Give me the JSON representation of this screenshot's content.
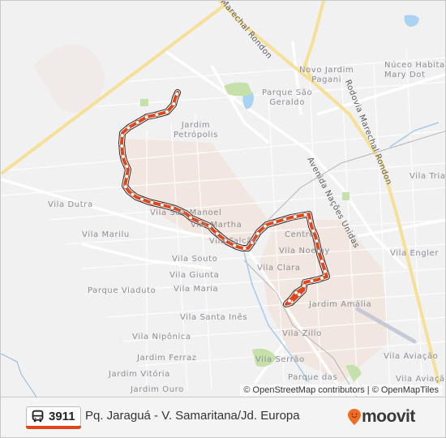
{
  "map": {
    "places": [
      {
        "id": "nucleo",
        "label": "Núceo Habita\nMary Dot"
      },
      {
        "id": "novo-jardim-pagani",
        "label": "Novo Jardim\nPagani"
      },
      {
        "id": "parque-sao-geraldo",
        "label": "Parque São\nGeraldo"
      },
      {
        "id": "jardim-petropolis",
        "label": "Jardim\nPetrópolis"
      },
      {
        "id": "vila-dutra",
        "label": "Vila Dutra"
      },
      {
        "id": "vila-marilu",
        "label": "Vila Marilu"
      },
      {
        "id": "vila-sao-manoel",
        "label": "Vila São Manoel"
      },
      {
        "id": "vila-martha",
        "label": "Vila Martha"
      },
      {
        "id": "vila-falcao",
        "label": "Vila Falcão"
      },
      {
        "id": "centro",
        "label": "Centro"
      },
      {
        "id": "vila-noemy",
        "label": "Vila Noemy"
      },
      {
        "id": "vila-clara",
        "label": "Vila Clara"
      },
      {
        "id": "vila-souto",
        "label": "Vila Souto"
      },
      {
        "id": "vila-giunta",
        "label": "Vila Giunta"
      },
      {
        "id": "vila-maria",
        "label": "Vila Maria"
      },
      {
        "id": "parque-viaduto",
        "label": "Parque Viaduto"
      },
      {
        "id": "vila-santa-ines",
        "label": "Vila Santa Inês"
      },
      {
        "id": "vila-niponica",
        "label": "Vila Nipônica"
      },
      {
        "id": "jardim-amalia",
        "label": "Jardim Amália"
      },
      {
        "id": "vila-zillo",
        "label": "Vila Zillo"
      },
      {
        "id": "jardim-ferraz",
        "label": "Jardim Ferraz"
      },
      {
        "id": "vila-serrao",
        "label": "Vila Serrão"
      },
      {
        "id": "jardim-vitoria",
        "label": "Jardim Vitória"
      },
      {
        "id": "jardim-ouro",
        "label": "Jardim Ouro"
      },
      {
        "id": "parque-das",
        "label": "Parque das"
      },
      {
        "id": "vila-triangulo",
        "label": "Vila Tria"
      },
      {
        "id": "vila-engler",
        "label": "Vila Engler"
      },
      {
        "id": "vila-aviacao-1",
        "label": "Vila Aviação"
      },
      {
        "id": "vila-aviacao-2",
        "label": "Vila Aviação"
      }
    ],
    "streets": [
      {
        "id": "marechal-rondon-top",
        "label": "Marechal Rondon"
      },
      {
        "id": "rodovia-marechal-rondon",
        "label": "Rodovia Marechal Rondon"
      },
      {
        "id": "avenida-nacoes-unidas",
        "label": "Avenida Nações Unidas"
      }
    ],
    "attribution": "© OpenStreetMap contributors | © OpenMapTiles",
    "colors": {
      "route": "#e0451b",
      "route_outline": "#2b2b2b",
      "highway": "#f7e19a",
      "water": "#a9d3f0",
      "park": "#c4dfa6"
    }
  },
  "footer": {
    "route_number": "3911",
    "route_name": "Pq. Jaraguá - V. Samaritana/Jd. Europa",
    "brand": "moovit",
    "brand_color": "#f26c21",
    "accent_color": "#e0451b"
  }
}
